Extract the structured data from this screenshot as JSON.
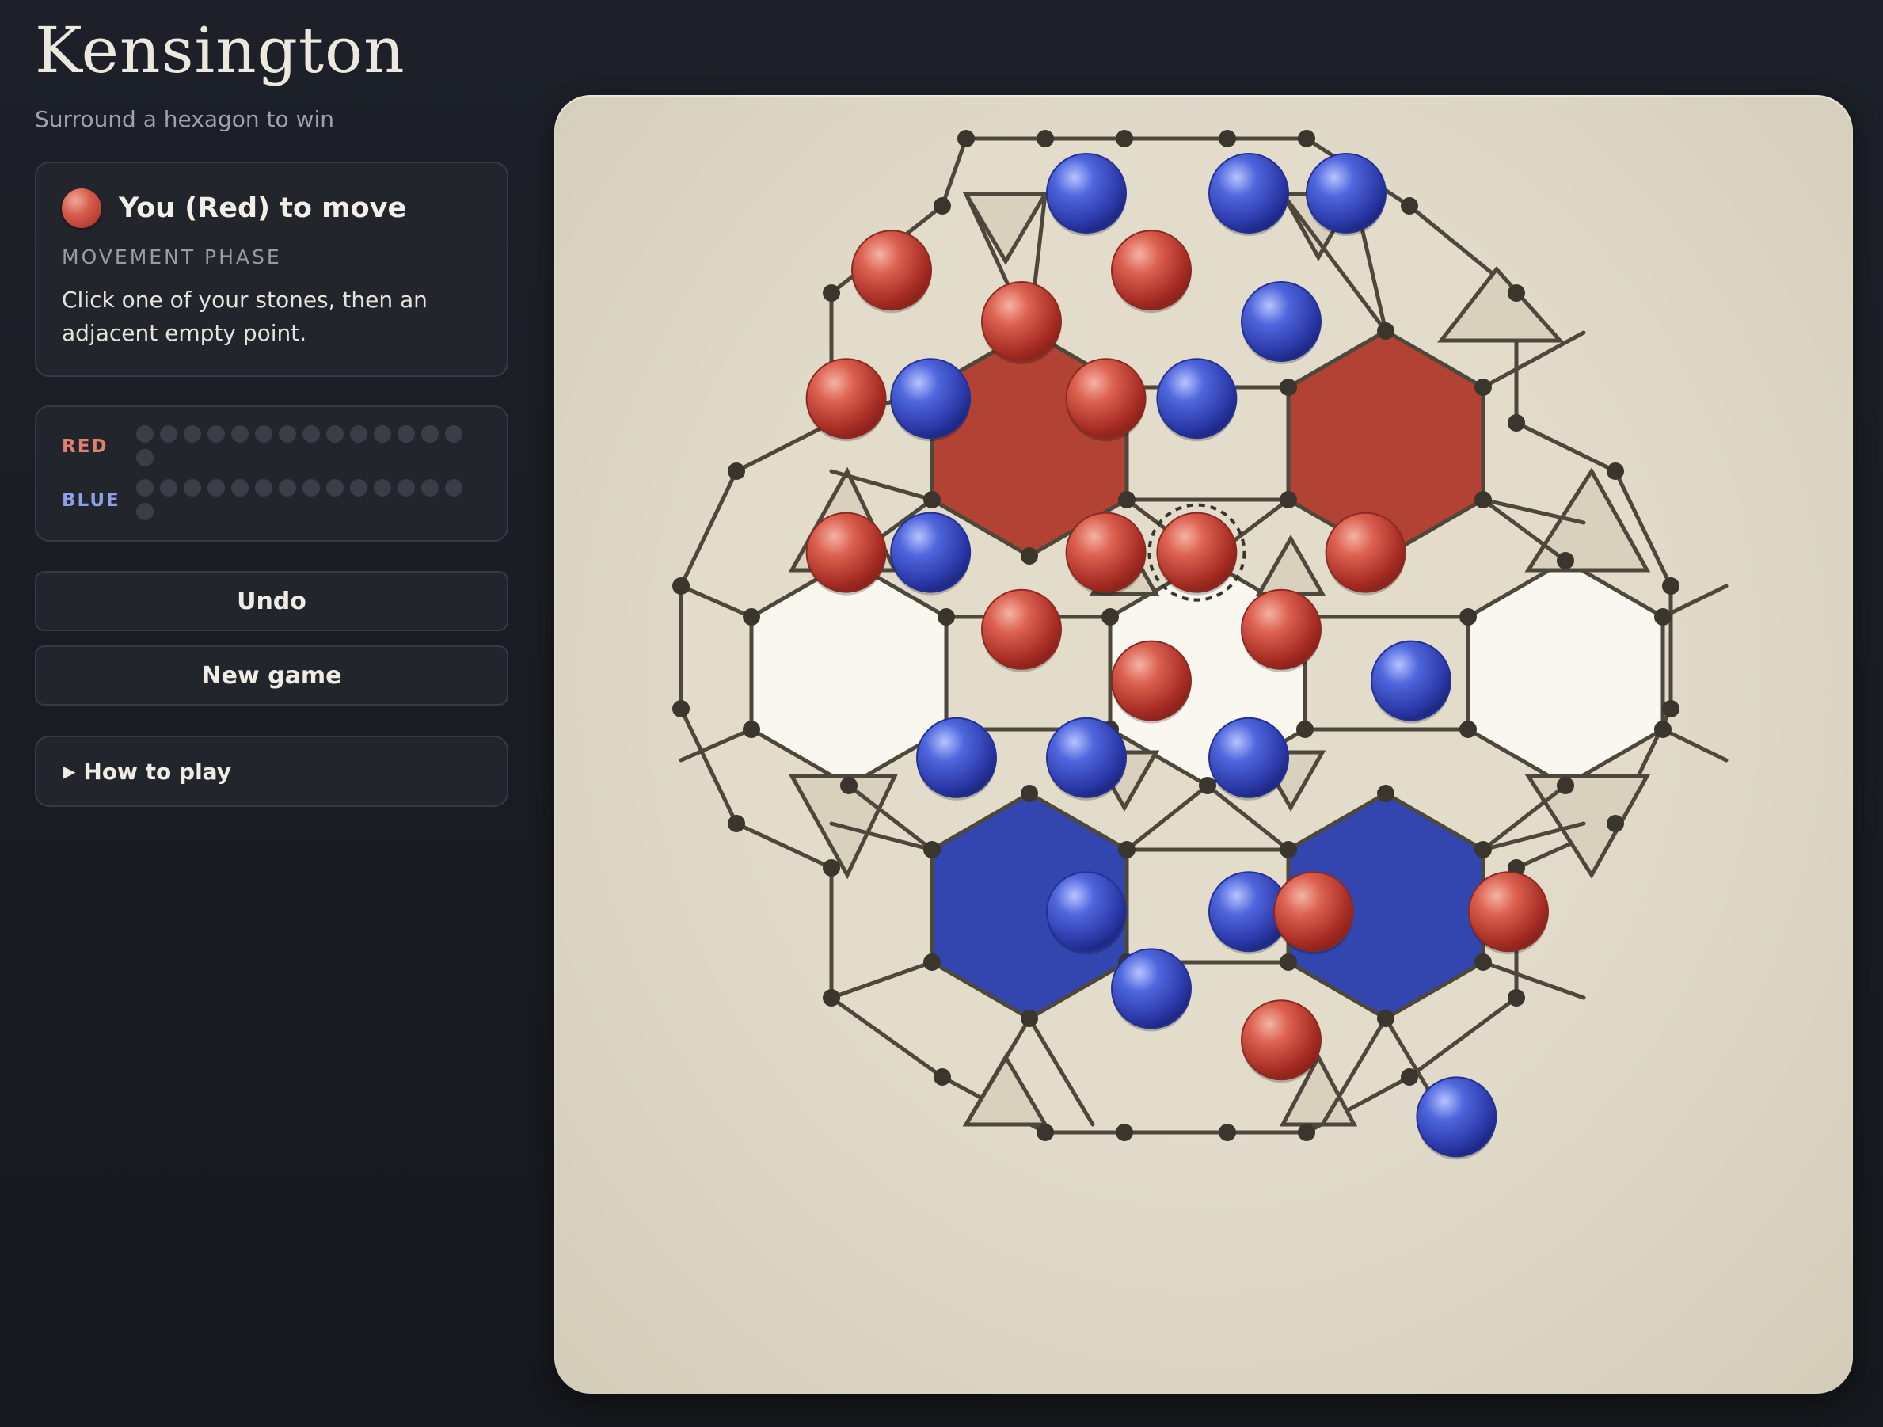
{
  "app": {
    "title": "Kensington",
    "subtitle": "Surround a hexagon to win"
  },
  "status": {
    "turn": "You (Red) to move",
    "phase": "MOVEMENT PHASE",
    "hint": "Click one of your stones, then an adjacent empty point."
  },
  "reserve": {
    "red_label": "RED",
    "blue_label": "BLUE",
    "red_remaining": 15,
    "blue_remaining": 15
  },
  "buttons": {
    "undo": "Undo",
    "new_game": "New game"
  },
  "howto": {
    "label": "How to play"
  },
  "colors": {
    "red": "#c9473a",
    "blue": "#3a4fc0",
    "red_hex_fill": "#b24334",
    "blue_hex_fill": "#3346b0",
    "white_hex_fill": "#faf7f0",
    "square_fill": "#e3dccb",
    "triangle_fill": "#d9d1bd",
    "line": "#4e473c",
    "node": "#3a352d"
  },
  "board": {
    "hexagons": [
      {
        "center": [
          5,
          4
        ],
        "color": "red"
      },
      {
        "center": [
          9,
          4
        ],
        "color": "red"
      },
      {
        "center": [
          3,
          7
        ],
        "color": "white"
      },
      {
        "center": [
          7,
          7
        ],
        "color": "white"
      },
      {
        "center": [
          11,
          7
        ],
        "color": "white"
      },
      {
        "center": [
          5,
          10
        ],
        "color": "blue"
      },
      {
        "center": [
          9,
          10
        ],
        "color": "blue"
      }
    ],
    "stones": [
      {
        "col": 6,
        "row": 0,
        "owner": "blue"
      },
      {
        "col": 8.5,
        "row": 0,
        "owner": "blue"
      },
      {
        "col": 10,
        "row": 0,
        "owner": "blue"
      },
      {
        "col": 3,
        "row": 0.6,
        "owner": "red"
      },
      {
        "col": 7,
        "row": 0.6,
        "owner": "red"
      },
      {
        "col": 5,
        "row": 1,
        "owner": "red"
      },
      {
        "col": 9,
        "row": 1,
        "owner": "blue"
      },
      {
        "col": 2.3,
        "row": 1.6,
        "owner": "red"
      },
      {
        "col": 3.6,
        "row": 1.6,
        "owner": "blue"
      },
      {
        "col": 6.3,
        "row": 1.6,
        "owner": "red"
      },
      {
        "col": 7.7,
        "row": 1.6,
        "owner": "blue"
      },
      {
        "col": 2.3,
        "row": 2.8,
        "owner": "red"
      },
      {
        "col": 3.6,
        "row": 2.8,
        "owner": "blue"
      },
      {
        "col": 6.3,
        "row": 2.8,
        "owner": "red"
      },
      {
        "col": 7.7,
        "row": 2.8,
        "owner": "red",
        "selected": true
      },
      {
        "col": 10.3,
        "row": 2.8,
        "owner": "red"
      },
      {
        "col": 5,
        "row": 3.4,
        "owner": "red"
      },
      {
        "col": 9,
        "row": 3.4,
        "owner": "red"
      },
      {
        "col": 7,
        "row": 3.8,
        "owner": "red"
      },
      {
        "col": 11,
        "row": 3.8,
        "owner": "blue"
      },
      {
        "col": 4,
        "row": 4.4,
        "owner": "blue"
      },
      {
        "col": 6,
        "row": 4.4,
        "owner": "blue"
      },
      {
        "col": 8.5,
        "row": 4.4,
        "owner": "blue"
      },
      {
        "col": 6,
        "row": 5.6,
        "owner": "blue"
      },
      {
        "col": 8.5,
        "row": 5.6,
        "owner": "blue"
      },
      {
        "col": 9.5,
        "row": 5.6,
        "owner": "red"
      },
      {
        "col": 12.5,
        "row": 5.6,
        "owner": "red"
      },
      {
        "col": 7,
        "row": 6.2,
        "owner": "blue"
      },
      {
        "col": 9,
        "row": 6.6,
        "owner": "red"
      },
      {
        "col": 11.7,
        "row": 7.2,
        "owner": "blue"
      }
    ]
  }
}
